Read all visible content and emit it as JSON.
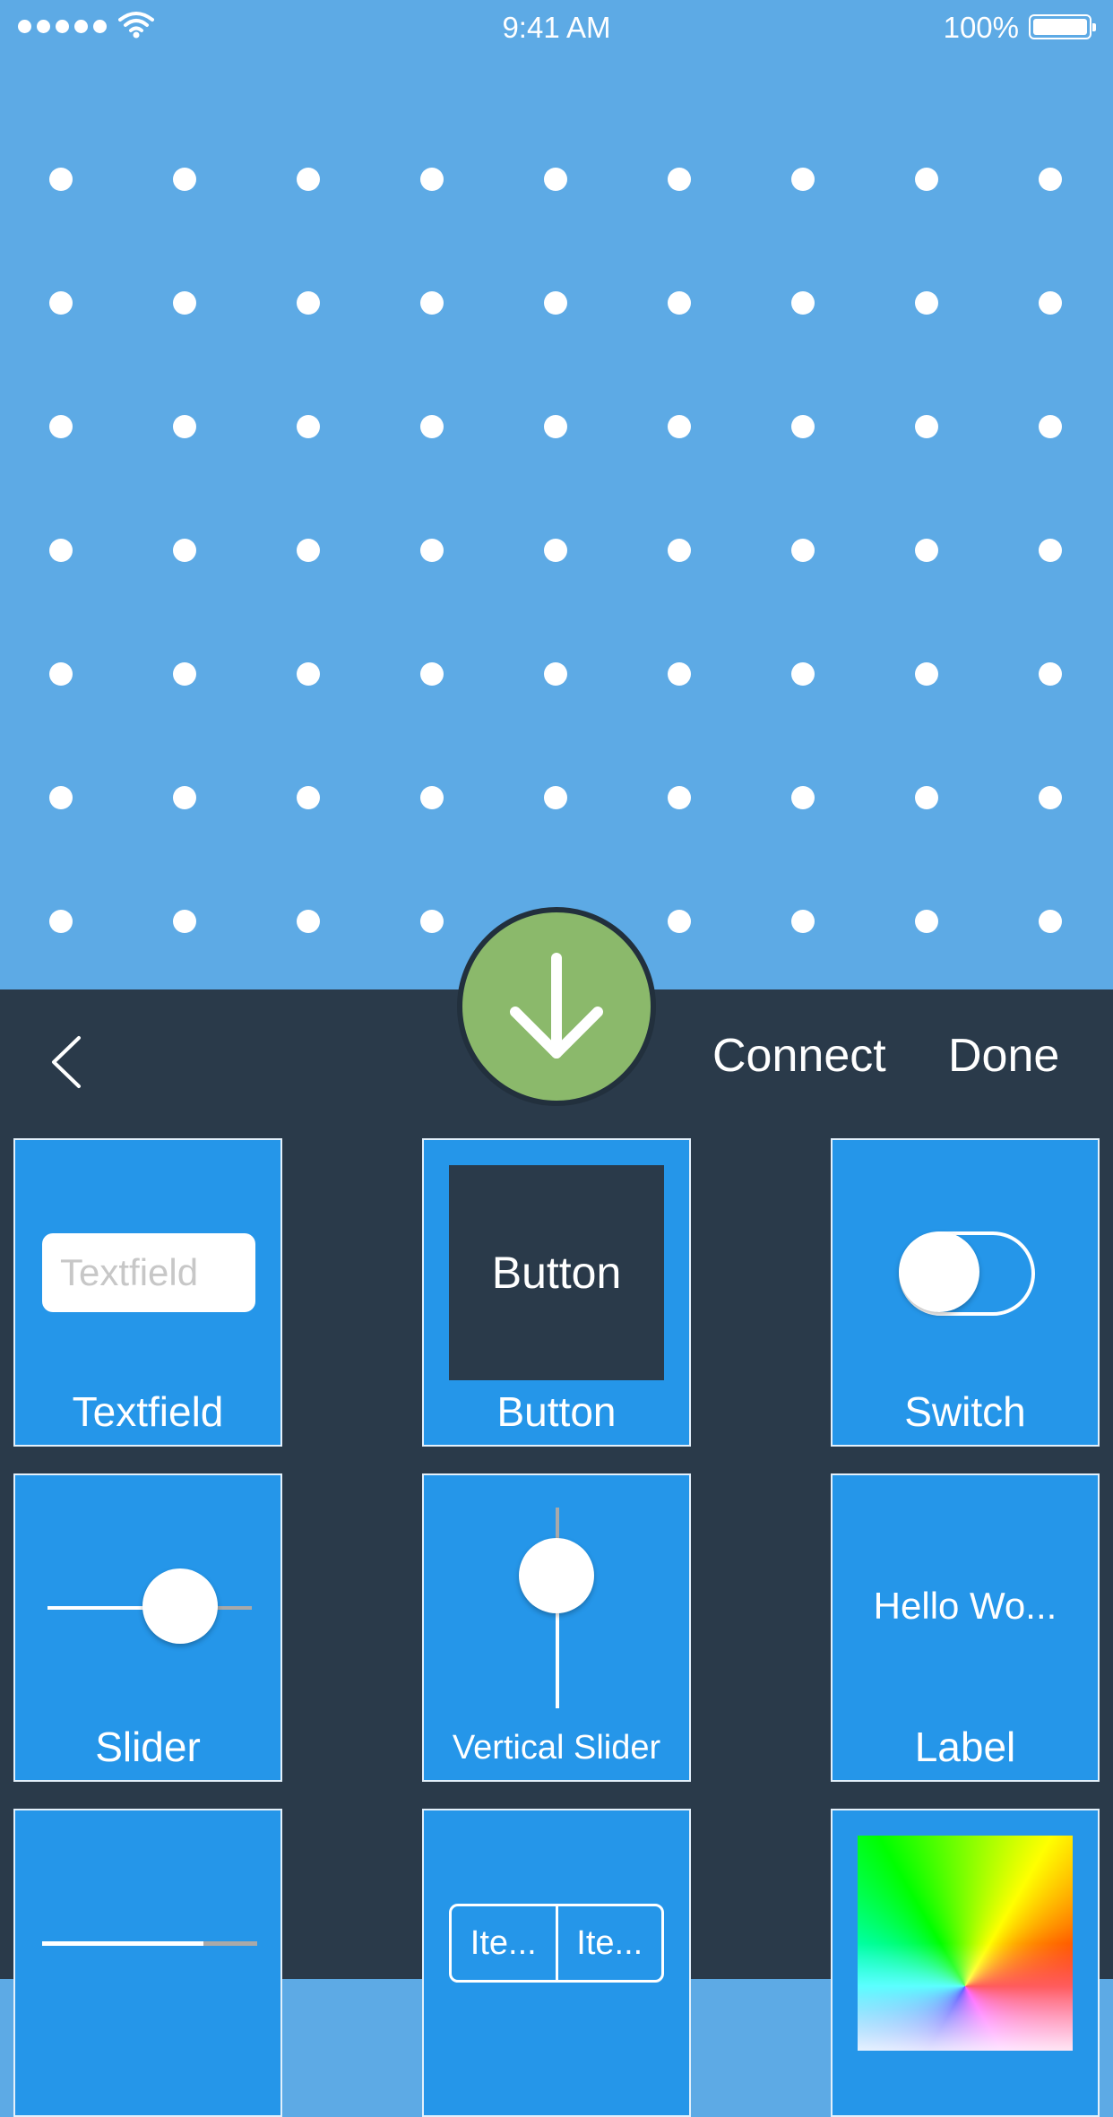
{
  "status_bar": {
    "time": "9:41 AM",
    "battery_percent": "100%",
    "signal_bars": 5,
    "icons": [
      "signal-dots-icon",
      "wifi-icon",
      "battery-icon"
    ]
  },
  "canvas": {
    "background_color": "#5DAAE5",
    "dot_color": "#FFFFFF",
    "dot_columns": 9,
    "dot_rows": 7
  },
  "toolbar": {
    "back_icon": "chevron-left-icon",
    "fab_icon": "arrow-down-icon",
    "connect_label": "Connect",
    "done_label": "Done"
  },
  "palette": {
    "textfield": {
      "label": "Textfield",
      "placeholder": "Textfield"
    },
    "button": {
      "label": "Button",
      "preview_text": "Button"
    },
    "switch": {
      "label": "Switch",
      "value": "off"
    },
    "slider": {
      "label": "Slider",
      "value_fraction": 0.5
    },
    "vertical_slider": {
      "label": "Vertical Slider",
      "value_fraction": 0.75
    },
    "label_tile": {
      "label": "Label",
      "preview_text": "Hello Wo..."
    },
    "progress": {
      "value_fraction": 0.75
    },
    "segmented": {
      "segments": [
        "Ite...",
        "Ite..."
      ]
    },
    "color_picker": {}
  },
  "colors": {
    "panel_background": "#2A3A4A",
    "tile_background": "#2596E9",
    "fab_green": "#8BB96B",
    "text": "#FFFFFF"
  }
}
